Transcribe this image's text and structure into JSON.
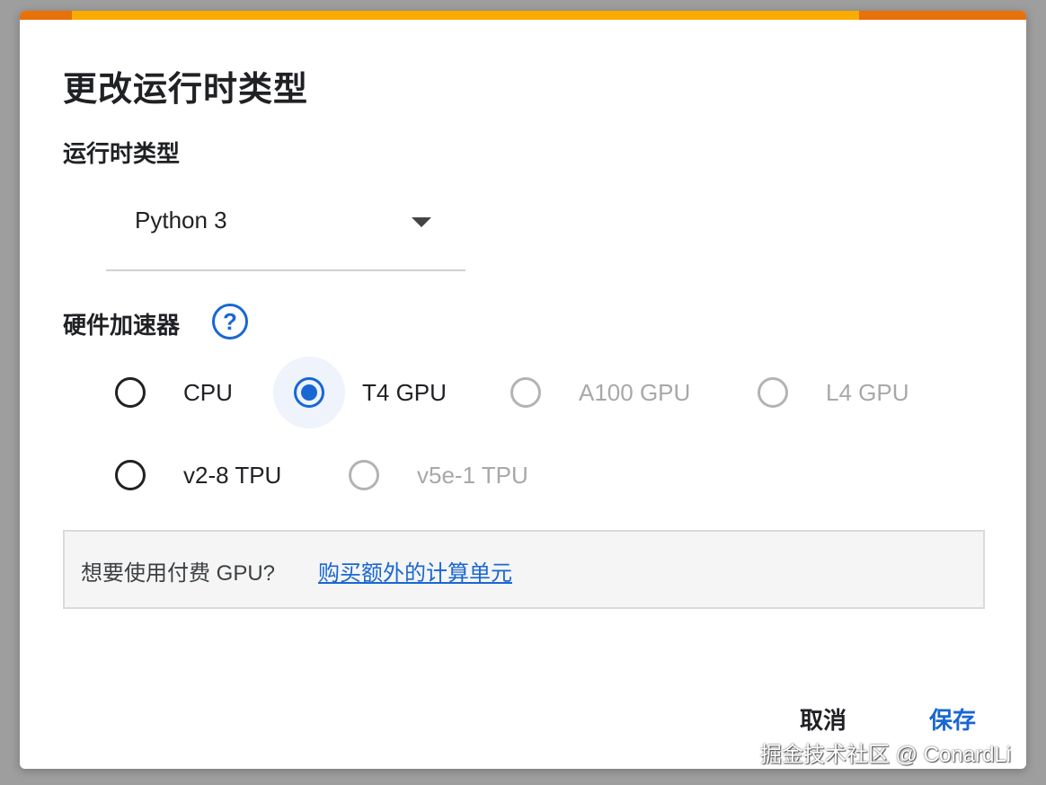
{
  "dialog": {
    "title": "更改运行时类型",
    "accent_colors": [
      "#e8710a",
      "#f9ab00"
    ]
  },
  "runtime": {
    "label": "运行时类型",
    "selected": "Python 3"
  },
  "hardware": {
    "label": "硬件加速器",
    "help_glyph": "?",
    "options": [
      {
        "label": "CPU",
        "checked": false,
        "disabled": false
      },
      {
        "label": "T4 GPU",
        "checked": true,
        "disabled": false
      },
      {
        "label": "A100 GPU",
        "checked": false,
        "disabled": true
      },
      {
        "label": "L4 GPU",
        "checked": false,
        "disabled": true
      },
      {
        "label": "v2-8 TPU",
        "checked": false,
        "disabled": false
      },
      {
        "label": "v5e-1 TPU",
        "checked": false,
        "disabled": true
      }
    ]
  },
  "info": {
    "text": "想要使用付费 GPU?",
    "link": "购买额外的计算单元"
  },
  "actions": {
    "cancel": "取消",
    "save": "保存"
  },
  "watermark": "掘金技术社区 @ ConardLi",
  "colors": {
    "primary": "#1967d2",
    "disabled": "#a8a8a8"
  }
}
